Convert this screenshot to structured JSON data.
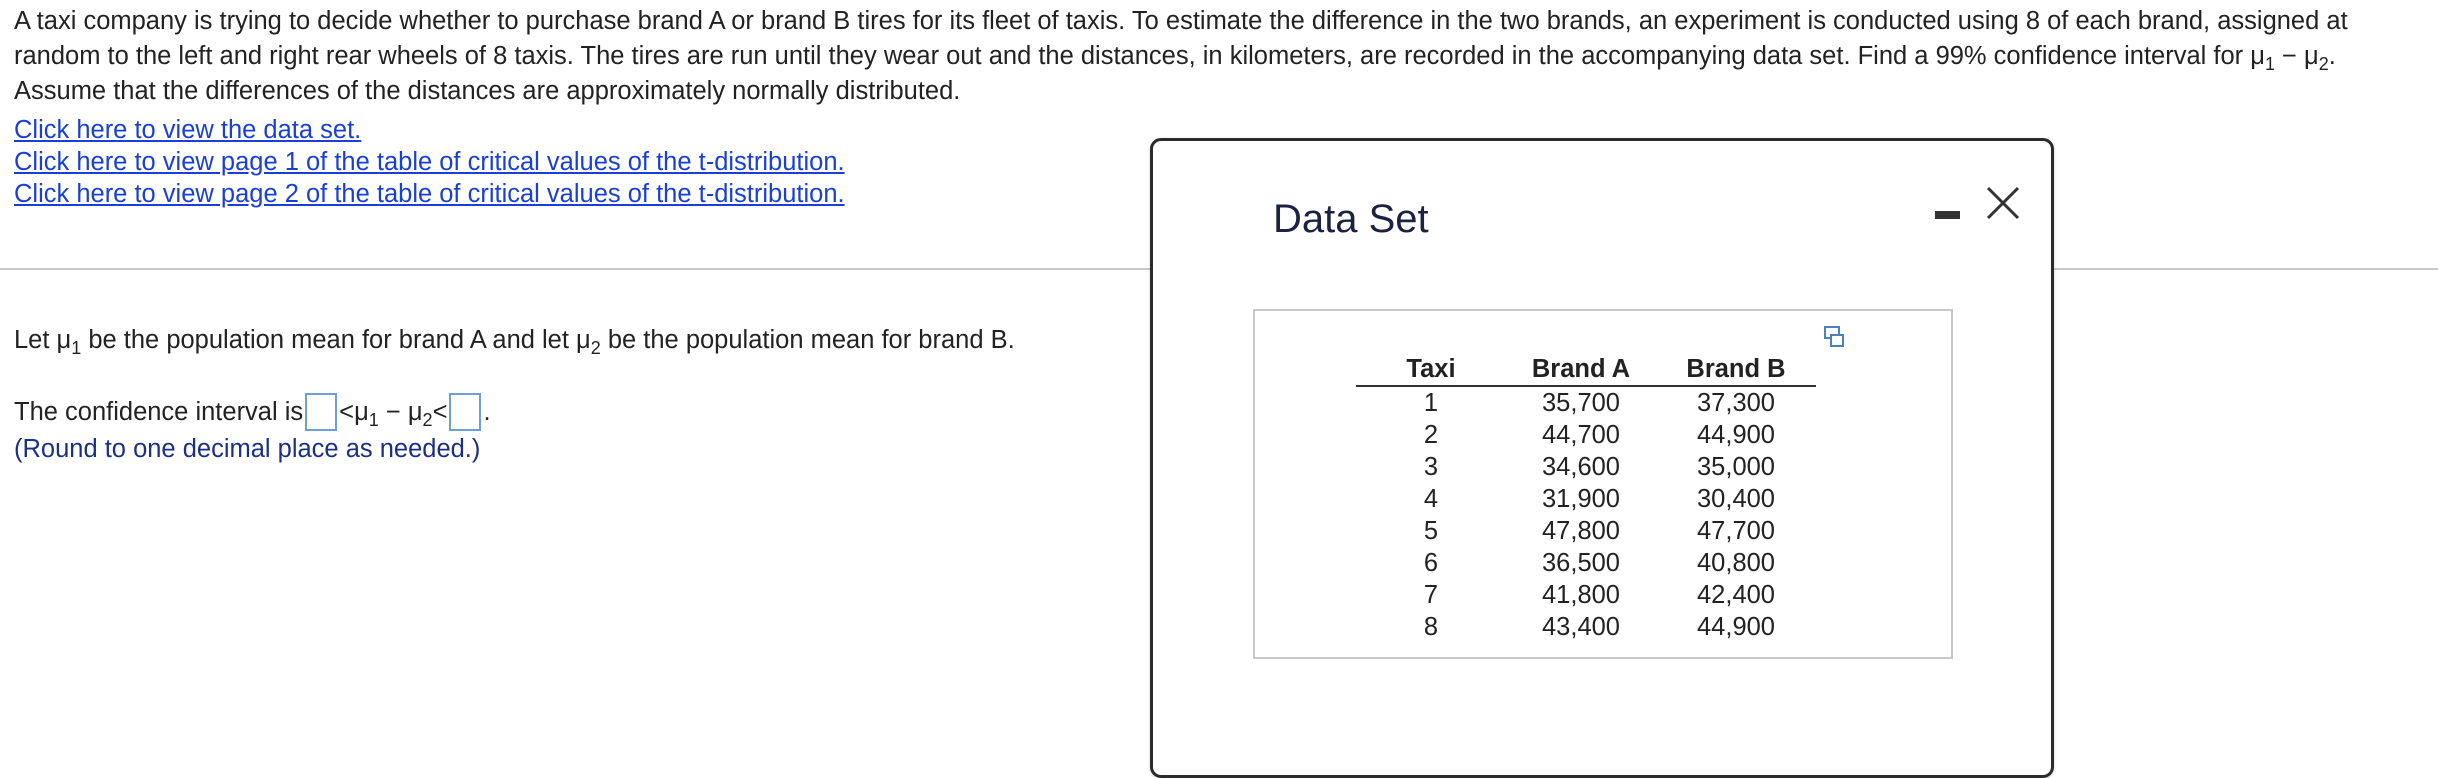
{
  "problem": {
    "text": "A taxi company is trying to decide whether to purchase brand A or brand B tires for its fleet of taxis. To estimate the difference in the two brands, an experiment is conducted using 8 of each brand, assigned at random to the left and right rear wheels of 8 taxis. The tires are run until they wear out and the distances, in kilometers, are recorded in the accompanying data set. Find a 99% confidence interval for μ",
    "sub1": "1",
    "mid": " − μ",
    "sub2": "2",
    "end": ". Assume that the differences of the distances are approximately normally distributed."
  },
  "links": [
    "Click here to view the data set.",
    "Click here to view page 1 of the table of critical values of the t-distribution.",
    "Click here to view page 2 of the table of critical values of the t-distribution."
  ],
  "let": {
    "part1": "Let μ",
    "sub1": "1",
    "part2": " be the population mean for brand A and let μ",
    "sub2": "2",
    "part3": " be the population mean for brand B."
  },
  "ci": {
    "prefix": "The confidence interval is ",
    "lt1": "<",
    "mu1": "μ",
    "sub1": "1",
    "minus": " − μ",
    "sub2": "2",
    "lt2": "<",
    "period": ".",
    "lower_value": "",
    "upper_value": ""
  },
  "note": "(Round to one decimal place as needed.)",
  "modal": {
    "title": "Data Set",
    "close_glyph": "✕",
    "icons": [
      "minimize-icon",
      "close-icon",
      "copy-icon"
    ]
  },
  "table": {
    "headers": [
      "Taxi",
      "Brand A",
      "Brand B"
    ],
    "rows": [
      [
        "1",
        "35,700",
        "37,300"
      ],
      [
        "2",
        "44,700",
        "44,900"
      ],
      [
        "3",
        "34,600",
        "35,000"
      ],
      [
        "4",
        "31,900",
        "30,400"
      ],
      [
        "5",
        "47,800",
        "47,700"
      ],
      [
        "6",
        "36,500",
        "40,800"
      ],
      [
        "7",
        "41,800",
        "42,400"
      ],
      [
        "8",
        "43,400",
        "44,900"
      ]
    ]
  },
  "colors": {
    "link": "#1a3fd6",
    "note": "#1b2f86",
    "input_border": "#6f9fd8",
    "modal_border": "#2b2b2b"
  }
}
